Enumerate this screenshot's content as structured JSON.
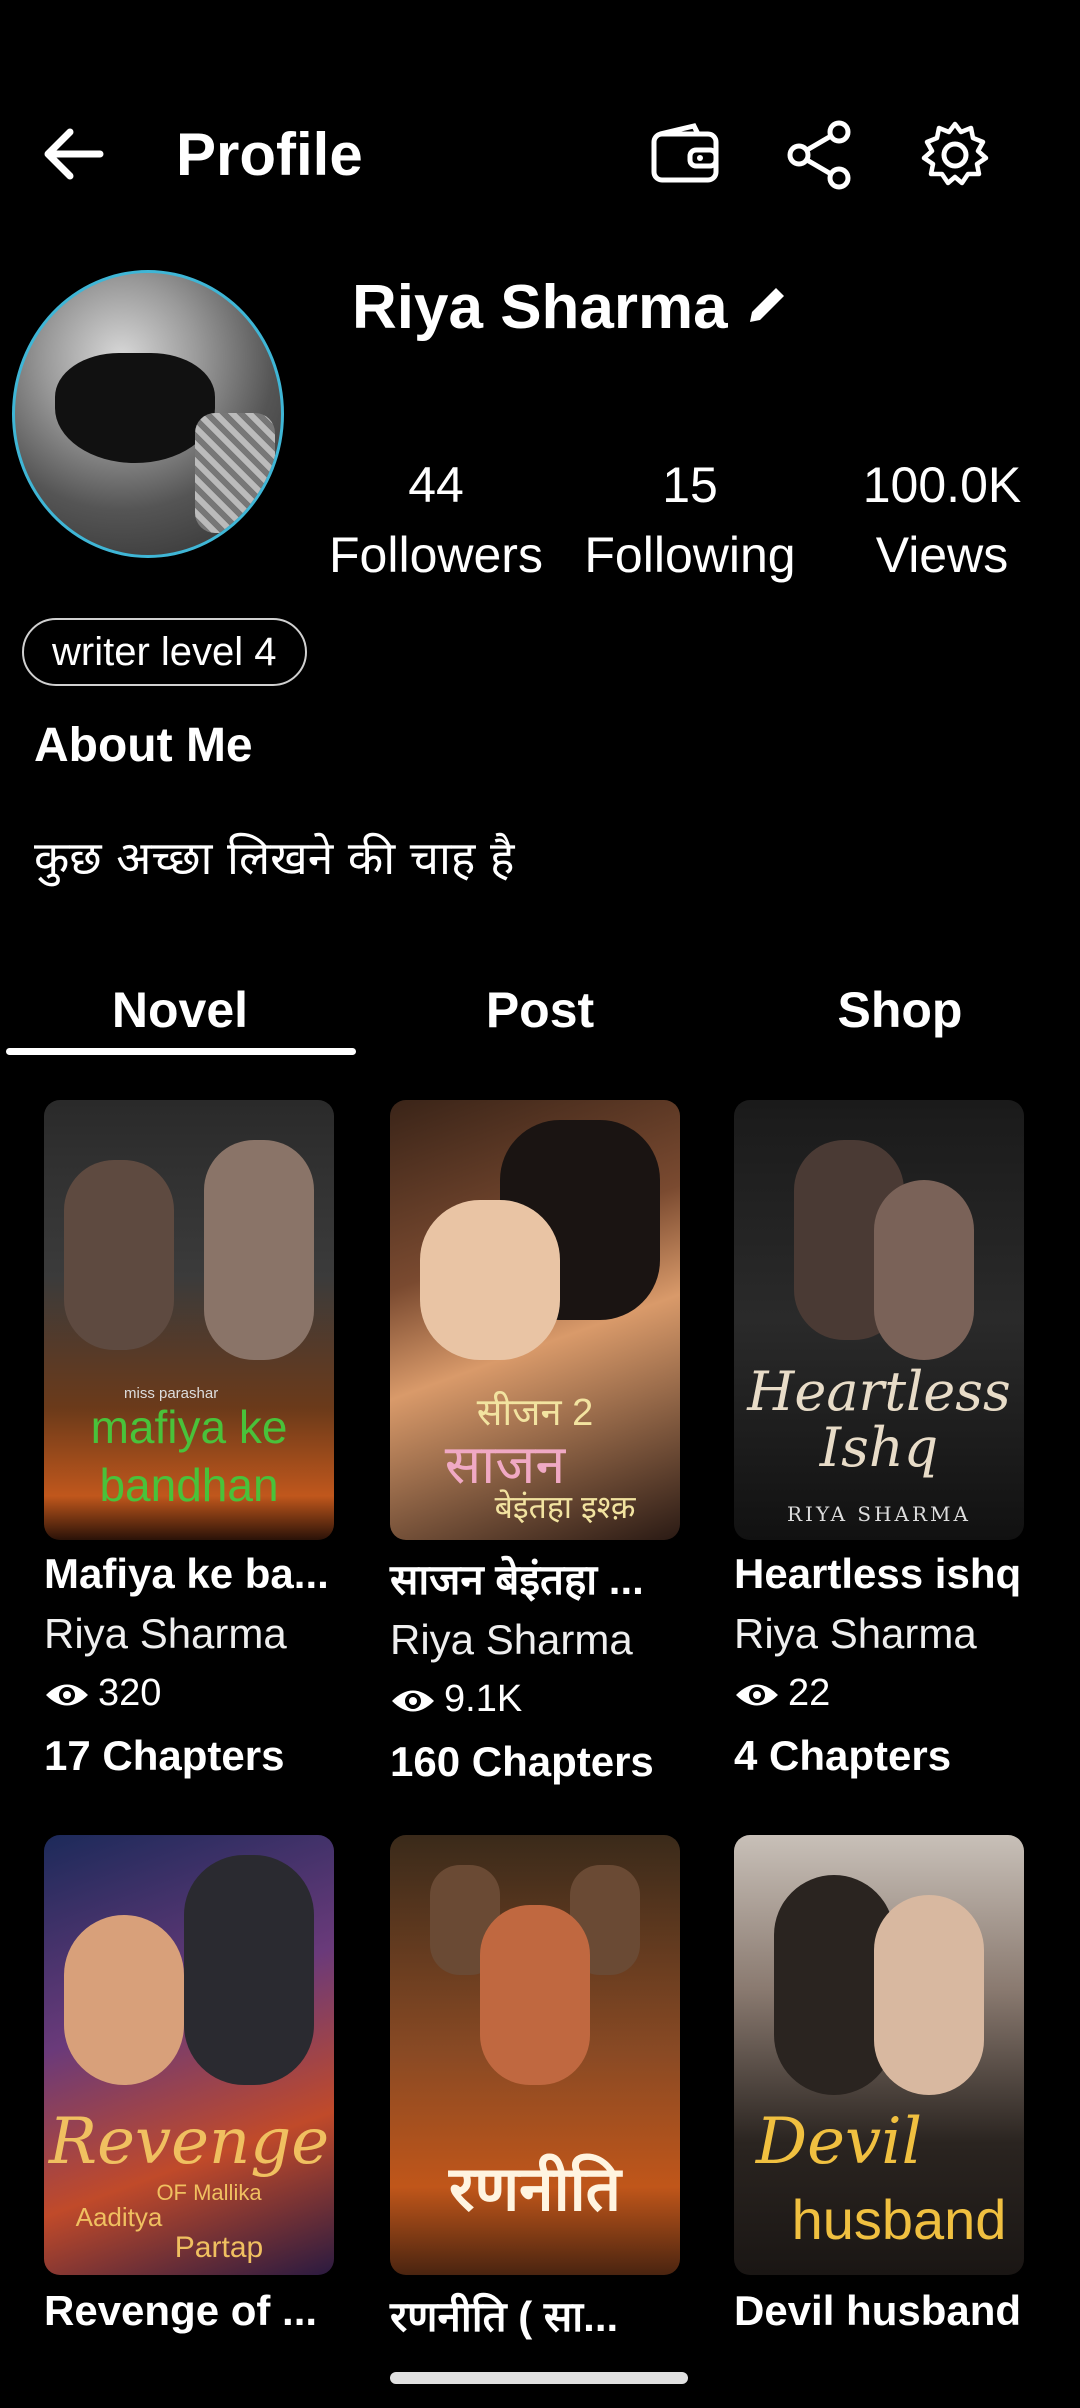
{
  "header": {
    "title": "Profile",
    "icons": [
      "back-arrow-icon",
      "wallet-icon",
      "share-icon",
      "settings-icon"
    ]
  },
  "profile": {
    "name": "Riya Sharma",
    "level": "writer level 4",
    "stats": [
      {
        "value": "44",
        "label": "Followers"
      },
      {
        "value": "15",
        "label": "Following"
      },
      {
        "value": "100.0K",
        "label": "Views"
      }
    ],
    "about_title": "About Me",
    "about_text": "कुछ अच्छा लिखने की चाह है"
  },
  "tabs": [
    {
      "label": "Novel",
      "active": true
    },
    {
      "label": "Post",
      "active": false
    },
    {
      "label": "Shop",
      "active": false
    }
  ],
  "novels": [
    {
      "title": "Mafiya ke ba...",
      "author": "Riya Sharma",
      "views": "320",
      "chapters": "17 Chapters",
      "cover_text": [
        "miss parashar",
        "mafiya ke",
        "bandhan"
      ]
    },
    {
      "title": "साजन बेइंतहा ...",
      "author": "Riya Sharma",
      "views": "9.1K",
      "chapters": "160 Chapters",
      "cover_text": [
        "सीजन 2",
        "साजन",
        "बेइंतहा इश्क़"
      ]
    },
    {
      "title": "Heartless ishq",
      "author": "Riya Sharma",
      "views": "22",
      "chapters": "4 Chapters",
      "cover_text": [
        "Heartless",
        "Ishq",
        "RIYA SHARMA"
      ]
    },
    {
      "title": "Revenge of ...",
      "cover_text": [
        "Revenge",
        "OF Mallika",
        "Aaditya",
        "Partap"
      ]
    },
    {
      "title": "रणनीति ( सा...",
      "cover_text": [
        "रणनीति"
      ]
    },
    {
      "title": "Devil husband",
      "cover_text": [
        "Devil",
        "husband"
      ]
    }
  ],
  "colors": {
    "background": "#000000",
    "avatar_ring": "#3fb6d6",
    "accent_green": "#49c23a"
  }
}
